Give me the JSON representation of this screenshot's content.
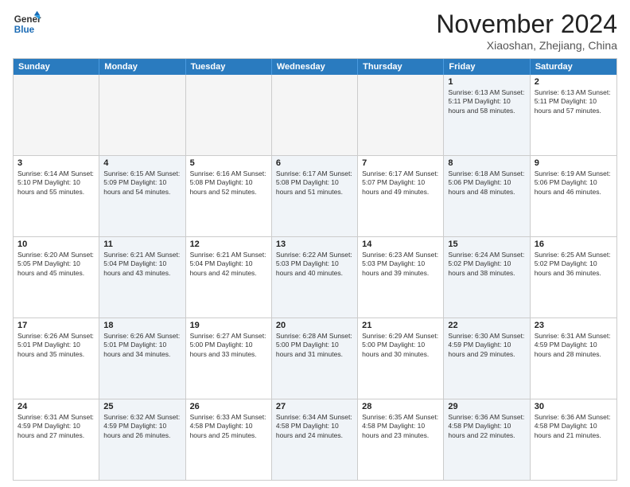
{
  "header": {
    "logo_line1": "General",
    "logo_line2": "Blue",
    "month_title": "November 2024",
    "location": "Xiaoshan, Zhejiang, China"
  },
  "weekdays": [
    "Sunday",
    "Monday",
    "Tuesday",
    "Wednesday",
    "Thursday",
    "Friday",
    "Saturday"
  ],
  "rows": [
    [
      {
        "day": "",
        "text": "",
        "empty": true
      },
      {
        "day": "",
        "text": "",
        "empty": true
      },
      {
        "day": "",
        "text": "",
        "empty": true
      },
      {
        "day": "",
        "text": "",
        "empty": true
      },
      {
        "day": "",
        "text": "",
        "empty": true
      },
      {
        "day": "1",
        "text": "Sunrise: 6:13 AM\nSunset: 5:11 PM\nDaylight: 10 hours\nand 58 minutes.",
        "shaded": true
      },
      {
        "day": "2",
        "text": "Sunrise: 6:13 AM\nSunset: 5:11 PM\nDaylight: 10 hours\nand 57 minutes.",
        "shaded": false
      }
    ],
    [
      {
        "day": "3",
        "text": "Sunrise: 6:14 AM\nSunset: 5:10 PM\nDaylight: 10 hours\nand 55 minutes.",
        "shaded": false
      },
      {
        "day": "4",
        "text": "Sunrise: 6:15 AM\nSunset: 5:09 PM\nDaylight: 10 hours\nand 54 minutes.",
        "shaded": true
      },
      {
        "day": "5",
        "text": "Sunrise: 6:16 AM\nSunset: 5:08 PM\nDaylight: 10 hours\nand 52 minutes.",
        "shaded": false
      },
      {
        "day": "6",
        "text": "Sunrise: 6:17 AM\nSunset: 5:08 PM\nDaylight: 10 hours\nand 51 minutes.",
        "shaded": true
      },
      {
        "day": "7",
        "text": "Sunrise: 6:17 AM\nSunset: 5:07 PM\nDaylight: 10 hours\nand 49 minutes.",
        "shaded": false
      },
      {
        "day": "8",
        "text": "Sunrise: 6:18 AM\nSunset: 5:06 PM\nDaylight: 10 hours\nand 48 minutes.",
        "shaded": true
      },
      {
        "day": "9",
        "text": "Sunrise: 6:19 AM\nSunset: 5:06 PM\nDaylight: 10 hours\nand 46 minutes.",
        "shaded": false
      }
    ],
    [
      {
        "day": "10",
        "text": "Sunrise: 6:20 AM\nSunset: 5:05 PM\nDaylight: 10 hours\nand 45 minutes.",
        "shaded": false
      },
      {
        "day": "11",
        "text": "Sunrise: 6:21 AM\nSunset: 5:04 PM\nDaylight: 10 hours\nand 43 minutes.",
        "shaded": true
      },
      {
        "day": "12",
        "text": "Sunrise: 6:21 AM\nSunset: 5:04 PM\nDaylight: 10 hours\nand 42 minutes.",
        "shaded": false
      },
      {
        "day": "13",
        "text": "Sunrise: 6:22 AM\nSunset: 5:03 PM\nDaylight: 10 hours\nand 40 minutes.",
        "shaded": true
      },
      {
        "day": "14",
        "text": "Sunrise: 6:23 AM\nSunset: 5:03 PM\nDaylight: 10 hours\nand 39 minutes.",
        "shaded": false
      },
      {
        "day": "15",
        "text": "Sunrise: 6:24 AM\nSunset: 5:02 PM\nDaylight: 10 hours\nand 38 minutes.",
        "shaded": true
      },
      {
        "day": "16",
        "text": "Sunrise: 6:25 AM\nSunset: 5:02 PM\nDaylight: 10 hours\nand 36 minutes.",
        "shaded": false
      }
    ],
    [
      {
        "day": "17",
        "text": "Sunrise: 6:26 AM\nSunset: 5:01 PM\nDaylight: 10 hours\nand 35 minutes.",
        "shaded": false
      },
      {
        "day": "18",
        "text": "Sunrise: 6:26 AM\nSunset: 5:01 PM\nDaylight: 10 hours\nand 34 minutes.",
        "shaded": true
      },
      {
        "day": "19",
        "text": "Sunrise: 6:27 AM\nSunset: 5:00 PM\nDaylight: 10 hours\nand 33 minutes.",
        "shaded": false
      },
      {
        "day": "20",
        "text": "Sunrise: 6:28 AM\nSunset: 5:00 PM\nDaylight: 10 hours\nand 31 minutes.",
        "shaded": true
      },
      {
        "day": "21",
        "text": "Sunrise: 6:29 AM\nSunset: 5:00 PM\nDaylight: 10 hours\nand 30 minutes.",
        "shaded": false
      },
      {
        "day": "22",
        "text": "Sunrise: 6:30 AM\nSunset: 4:59 PM\nDaylight: 10 hours\nand 29 minutes.",
        "shaded": true
      },
      {
        "day": "23",
        "text": "Sunrise: 6:31 AM\nSunset: 4:59 PM\nDaylight: 10 hours\nand 28 minutes.",
        "shaded": false
      }
    ],
    [
      {
        "day": "24",
        "text": "Sunrise: 6:31 AM\nSunset: 4:59 PM\nDaylight: 10 hours\nand 27 minutes.",
        "shaded": false
      },
      {
        "day": "25",
        "text": "Sunrise: 6:32 AM\nSunset: 4:59 PM\nDaylight: 10 hours\nand 26 minutes.",
        "shaded": true
      },
      {
        "day": "26",
        "text": "Sunrise: 6:33 AM\nSunset: 4:58 PM\nDaylight: 10 hours\nand 25 minutes.",
        "shaded": false
      },
      {
        "day": "27",
        "text": "Sunrise: 6:34 AM\nSunset: 4:58 PM\nDaylight: 10 hours\nand 24 minutes.",
        "shaded": true
      },
      {
        "day": "28",
        "text": "Sunrise: 6:35 AM\nSunset: 4:58 PM\nDaylight: 10 hours\nand 23 minutes.",
        "shaded": false
      },
      {
        "day": "29",
        "text": "Sunrise: 6:36 AM\nSunset: 4:58 PM\nDaylight: 10 hours\nand 22 minutes.",
        "shaded": true
      },
      {
        "day": "30",
        "text": "Sunrise: 6:36 AM\nSunset: 4:58 PM\nDaylight: 10 hours\nand 21 minutes.",
        "shaded": false
      }
    ]
  ]
}
